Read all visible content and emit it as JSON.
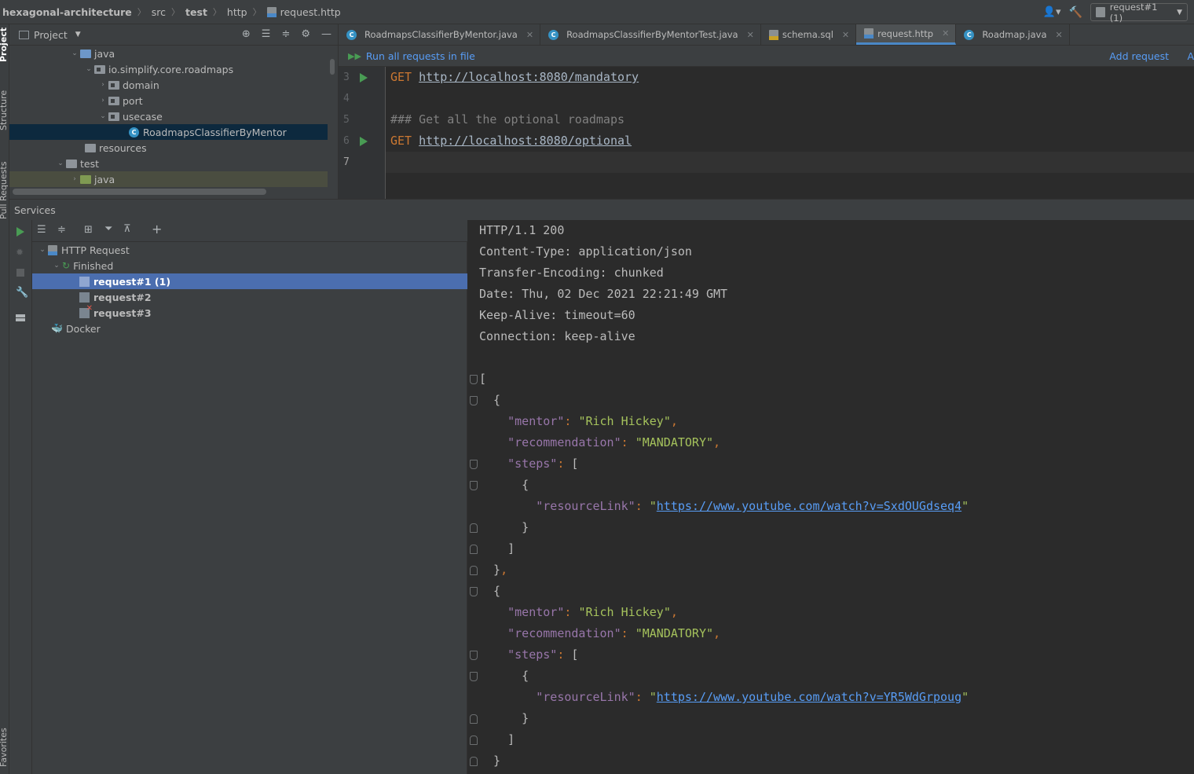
{
  "breadcrumb": [
    "hexagonal-architecture",
    "src",
    "test",
    "http",
    "request.http"
  ],
  "run_config": "request#1 (1)",
  "left_strip": {
    "project": "Project",
    "structure": "Structure",
    "pull_requests": "Pull Requests",
    "favorites": "Favorites"
  },
  "project": {
    "header": "Project",
    "tree": [
      {
        "label": "java",
        "depth": 0
      },
      {
        "label": "io.simplify.core.roadmaps",
        "depth": 1
      },
      {
        "label": "domain",
        "depth": 2
      },
      {
        "label": "port",
        "depth": 2
      },
      {
        "label": "usecase",
        "depth": 2
      },
      {
        "label": "RoadmapsClassifierByMentor",
        "depth": 3
      },
      {
        "label": "resources",
        "depth": 0
      },
      {
        "label": "test",
        "depth": -1
      },
      {
        "label": "java",
        "depth": 0
      }
    ]
  },
  "tabs": [
    {
      "label": "RoadmapsClassifierByMentor.java"
    },
    {
      "label": "RoadmapsClassifierByMentorTest.java"
    },
    {
      "label": "schema.sql"
    },
    {
      "label": "request.http",
      "active": true
    },
    {
      "label": "Roadmap.java"
    }
  ],
  "runbar": {
    "run_all": "Run all requests in file",
    "add_request": "Add request",
    "add_more": "A"
  },
  "editor": {
    "lines": [
      {
        "num": "3",
        "method": "GET",
        "url": "http://localhost:8080/mandatory"
      },
      {
        "num": "4"
      },
      {
        "num": "5",
        "comment": "### Get all the optional roadmaps"
      },
      {
        "num": "6",
        "method": "GET",
        "url": "http://localhost:8080/optional"
      },
      {
        "num": "7"
      }
    ]
  },
  "services": {
    "title": "Services",
    "tree": {
      "http_request": "HTTP Request",
      "finished": "Finished",
      "requests": [
        "request#1 (1)",
        "request#2",
        "request#3"
      ],
      "docker": "Docker"
    }
  },
  "response": {
    "headers": [
      "HTTP/1.1 200",
      "Content-Type: application/json",
      "Transfer-Encoding: chunked",
      "Date: Thu, 02 Dec 2021 22:21:49 GMT",
      "Keep-Alive: timeout=60",
      "Connection: keep-alive"
    ],
    "items": [
      {
        "mentor": "Rich Hickey",
        "recommendation": "MANDATORY",
        "resourceLink": "https://www.youtube.com/watch?v=SxdOUGdseq4"
      },
      {
        "mentor": "Rich Hickey",
        "recommendation": "MANDATORY",
        "resourceLink": "https://www.youtube.com/watch?v=YR5WdGrpoug"
      }
    ],
    "keys": {
      "mentor": "\"mentor\"",
      "recommendation": "\"recommendation\"",
      "steps": "\"steps\"",
      "resourceLink": "\"resourceLink\""
    }
  },
  "colors": {
    "accent": "#4a88c7",
    "selection": "#4b6eaf",
    "run_green": "#499c54",
    "link": "#589df6"
  }
}
